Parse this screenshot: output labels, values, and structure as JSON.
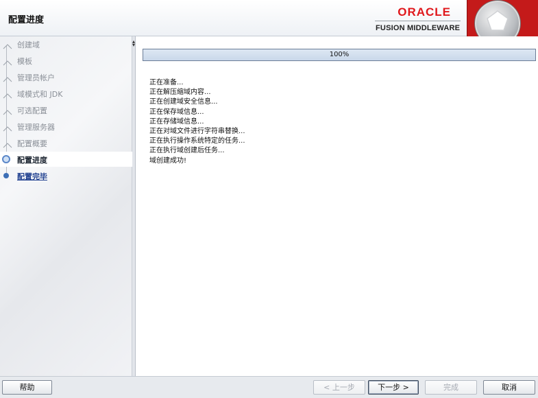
{
  "header": {
    "title": "配置进度",
    "brand_oracle": "ORACLE",
    "brand_fusion": "FUSION MIDDLEWARE"
  },
  "sidebar": {
    "steps": [
      {
        "label": "创建域",
        "state": "done"
      },
      {
        "label": "模板",
        "state": "done"
      },
      {
        "label": "管理员帐户",
        "state": "done"
      },
      {
        "label": "域模式和 JDK",
        "state": "done"
      },
      {
        "label": "可选配置",
        "state": "done"
      },
      {
        "label": "管理服务器",
        "state": "done"
      },
      {
        "label": "配置概要",
        "state": "done"
      },
      {
        "label": "配置进度",
        "state": "current"
      },
      {
        "label": "配置完毕",
        "state": "next"
      }
    ]
  },
  "progress": {
    "percent": 100,
    "label": "100%"
  },
  "log": [
    "正在准备...",
    "正在解压缩域内容...",
    "正在创建域安全信息...",
    "正在保存域信息...",
    "正在存储域信息...",
    "正在对域文件进行字符串替换...",
    "正在执行操作系统特定的任务...",
    "正在执行域创建后任务...",
    "域创建成功!"
  ],
  "footer": {
    "help": "帮助",
    "back": "< 上一步",
    "next": "下一步 >",
    "finish": "完成",
    "cancel": "取消"
  },
  "colors": {
    "oracle_red": "#e0171b",
    "progress_border": "#6a7c96",
    "current_step": "#1b2430",
    "next_step_link": "#1f3f8f"
  }
}
